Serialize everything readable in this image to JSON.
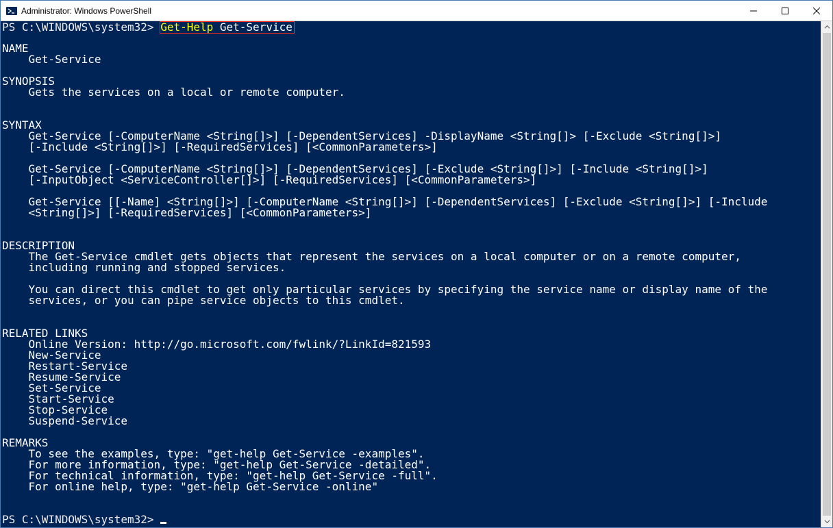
{
  "window": {
    "title": "Administrator: Windows PowerShell"
  },
  "colors": {
    "console_bg": "#012456",
    "console_fg": "#ffffff",
    "highlight_border": "#ff2d1a",
    "cmd_yellow": "#ffff00"
  },
  "prompt1": {
    "text": "PS C:\\WINDOWS\\system32> ",
    "highlighted_cmd": "Get-Help",
    "highlighted_arg": " Get-Service"
  },
  "help": {
    "section_name_hdr": "NAME",
    "name": "    Get-Service",
    "section_synopsis_hdr": "SYNOPSIS",
    "synopsis": "    Gets the services on a local or remote computer.",
    "section_syntax_hdr": "SYNTAX",
    "syntax_lines": [
      "    Get-Service [-ComputerName <String[]>] [-DependentServices] -DisplayName <String[]> [-Exclude <String[]>]",
      "    [-Include <String[]>] [-RequiredServices] [<CommonParameters>]",
      "",
      "    Get-Service [-ComputerName <String[]>] [-DependentServices] [-Exclude <String[]>] [-Include <String[]>]",
      "    [-InputObject <ServiceController[]>] [-RequiredServices] [<CommonParameters>]",
      "",
      "    Get-Service [[-Name] <String[]>] [-ComputerName <String[]>] [-DependentServices] [-Exclude <String[]>] [-Include",
      "    <String[]>] [-RequiredServices] [<CommonParameters>]"
    ],
    "section_description_hdr": "DESCRIPTION",
    "description_lines": [
      "    The Get-Service cmdlet gets objects that represent the services on a local computer or on a remote computer,",
      "    including running and stopped services.",
      "",
      "    You can direct this cmdlet to get only particular services by specifying the service name or display name of the",
      "    services, or you can pipe service objects to this cmdlet."
    ],
    "section_related_hdr": "RELATED LINKS",
    "related_lines": [
      "    Online Version: http://go.microsoft.com/fwlink/?LinkId=821593",
      "    New-Service",
      "    Restart-Service",
      "    Resume-Service",
      "    Set-Service",
      "    Start-Service",
      "    Stop-Service",
      "    Suspend-Service"
    ],
    "section_remarks_hdr": "REMARKS",
    "remarks_lines": [
      "    To see the examples, type: \"get-help Get-Service -examples\".",
      "    For more information, type: \"get-help Get-Service -detailed\".",
      "    For technical information, type: \"get-help Get-Service -full\".",
      "    For online help, type: \"get-help Get-Service -online\""
    ]
  },
  "prompt2": {
    "text": "PS C:\\WINDOWS\\system32> "
  }
}
